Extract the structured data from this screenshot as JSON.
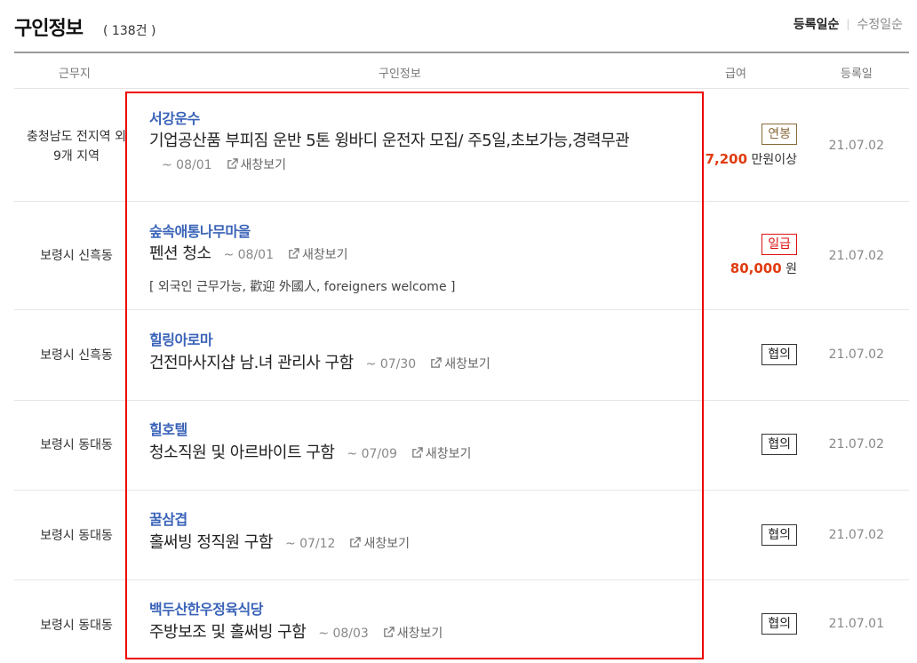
{
  "header": {
    "title": "구인정보",
    "count": "( 138건 )",
    "sort_active": "등록일순",
    "sort_sep": "|",
    "sort_inactive": "수정일순"
  },
  "columns": {
    "location": "근무지",
    "info": "구인정보",
    "salary": "급여",
    "date": "등록일"
  },
  "rows": [
    {
      "location": "충청남도 전지역 외 9개 지역",
      "company": "서강운수",
      "job": "기업공산품 부피짐 운반 5톤 윙바디 운전자 모집/ 주5일,초보가능,경력무관",
      "deadline": "~ 08/01",
      "newwin": "새창보기",
      "pay_type": "연봉",
      "pay_amount": "7,200",
      "pay_unit": "만원이상",
      "date": "21.07.02"
    },
    {
      "location": "보령시 신흑동",
      "company": "숲속애통나무마을",
      "job": "펜션 청소",
      "deadline": "~ 08/01",
      "newwin": "새창보기",
      "note": "[ 외국인 근무가능, 歡迎 外國人, foreigners welcome ]",
      "pay_type": "일급",
      "pay_amount": "80,000",
      "pay_unit": "원",
      "date": "21.07.02"
    },
    {
      "location": "보령시 신흑동",
      "company": "힐링아로마",
      "job": "건전마사지샵 남.녀 관리사 구함",
      "deadline": "~ 07/30",
      "newwin": "새창보기",
      "pay_type": "협의",
      "date": "21.07.02"
    },
    {
      "location": "보령시 동대동",
      "company": "힐호텔",
      "job": "청소직원 및 아르바이트 구함",
      "deadline": "~ 07/09",
      "newwin": "새창보기",
      "pay_type": "협의",
      "date": "21.07.02"
    },
    {
      "location": "보령시 동대동",
      "company": "꿀삼겹",
      "job": "홀써빙 정직원 구함",
      "deadline": "~ 07/12",
      "newwin": "새창보기",
      "pay_type": "협의",
      "date": "21.07.02"
    },
    {
      "location": "보령시 동대동",
      "company": "백두산한우정육식당",
      "job": "주방보조 및 홀써빙 구함",
      "deadline": "~ 08/03",
      "newwin": "새창보기",
      "pay_type": "협의",
      "date": "21.07.01"
    }
  ],
  "colors": {
    "company": "#3a63b8",
    "amount": "#e03b10",
    "highlight": "#e00000"
  },
  "icons": {
    "newwin": "external-link-icon"
  }
}
